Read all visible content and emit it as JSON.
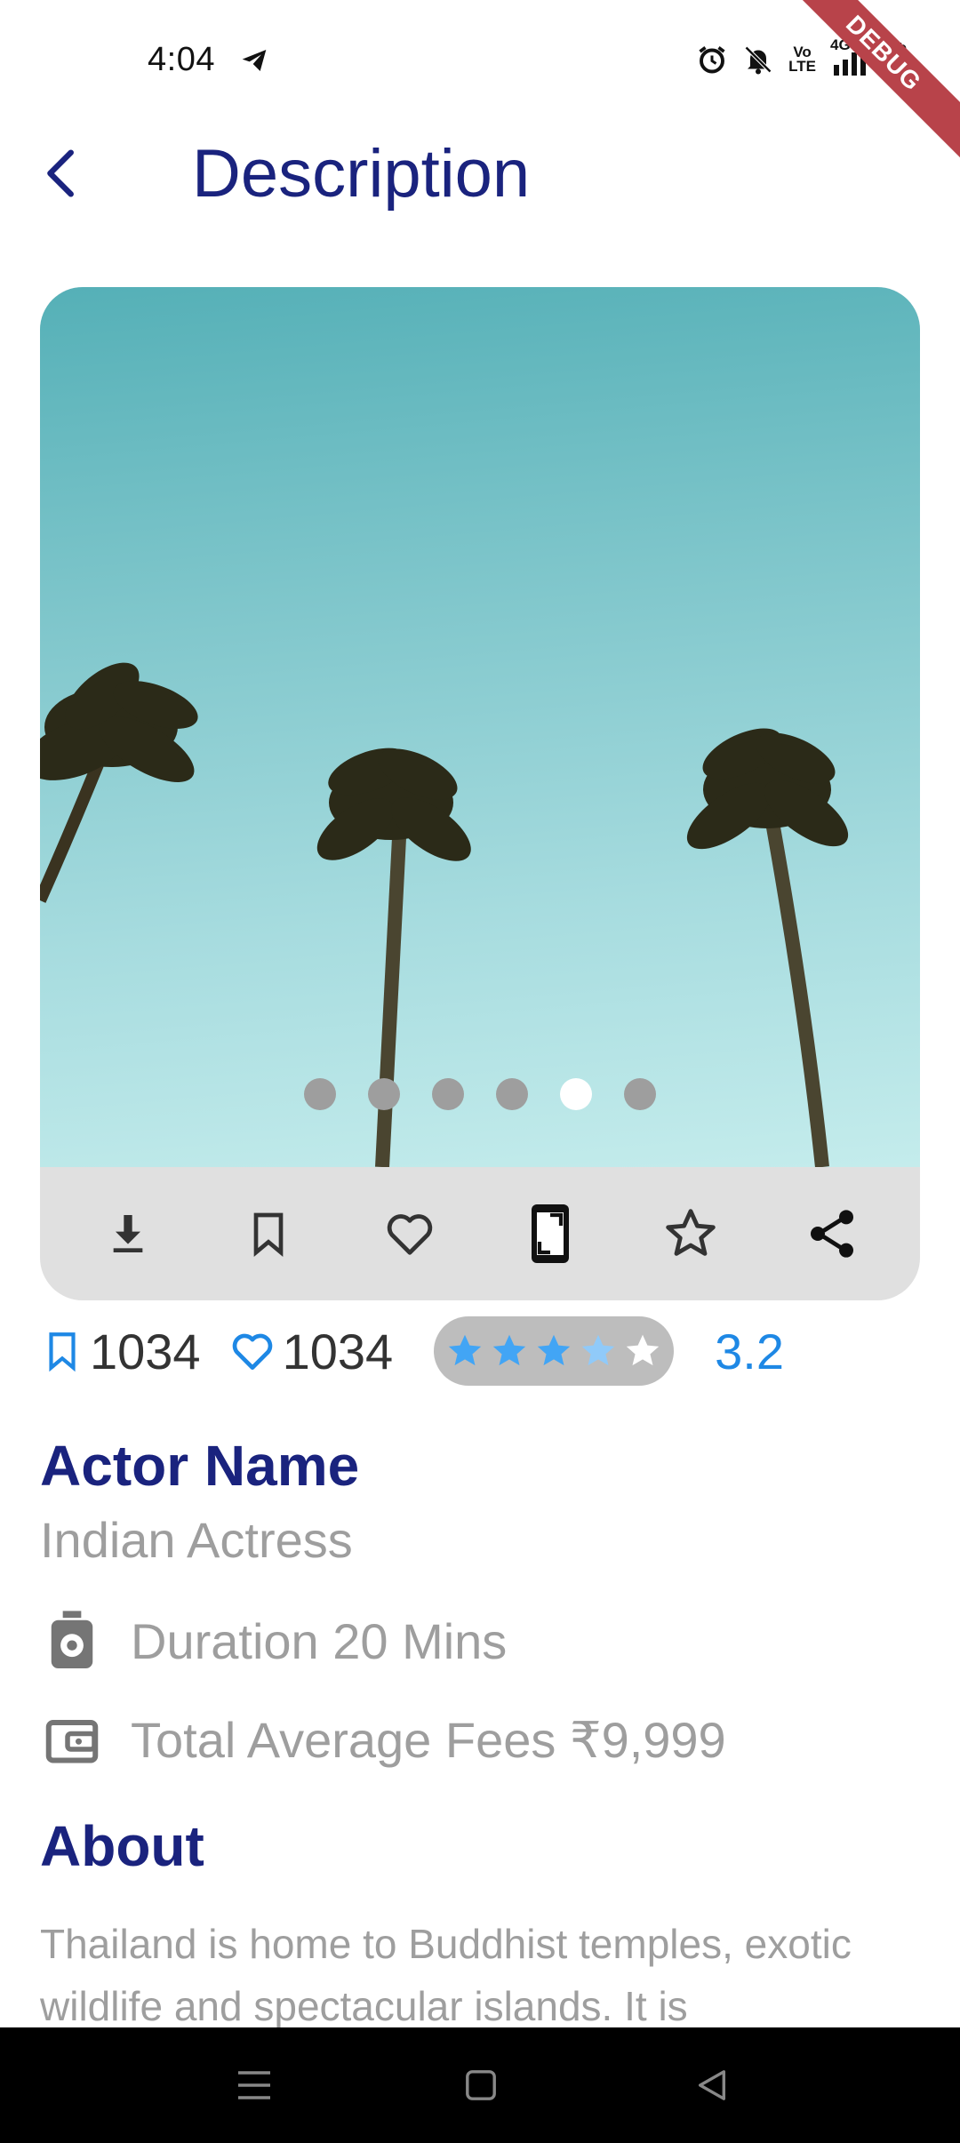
{
  "status_bar": {
    "time": "4:04",
    "network": "4G",
    "volte_line1": "Vo",
    "volte_line2": "LTE",
    "debug_label": "DEBUG"
  },
  "appbar": {
    "title": "Description",
    "back_icon": "chevron-left-icon"
  },
  "carousel": {
    "page_count": 6,
    "active_index": 4,
    "actions": [
      {
        "name": "download-icon"
      },
      {
        "name": "bookmark-icon"
      },
      {
        "name": "heart-icon"
      },
      {
        "name": "set-wallpaper-icon"
      },
      {
        "name": "star-icon"
      },
      {
        "name": "share-icon"
      }
    ]
  },
  "stats": {
    "bookmarks": "1034",
    "likes": "1034",
    "rating_value": "3.2",
    "rating_stars": 3.5,
    "rating_max": 5
  },
  "details": {
    "actor_name": "Actor Name",
    "actor_role": "Indian Actress",
    "duration": "Duration 20 Mins",
    "fees": "Total Average Fees ₹9,999",
    "about_title": "About",
    "about_text": "Thailand is home to Buddhist temples, exotic wildlife and spectacular islands. It is"
  },
  "colors": {
    "primary": "#1a237e",
    "accent": "#1e88e5",
    "muted": "#9e9e9e",
    "star_filled": "#42a5f5",
    "star_empty": "#ffffff"
  }
}
